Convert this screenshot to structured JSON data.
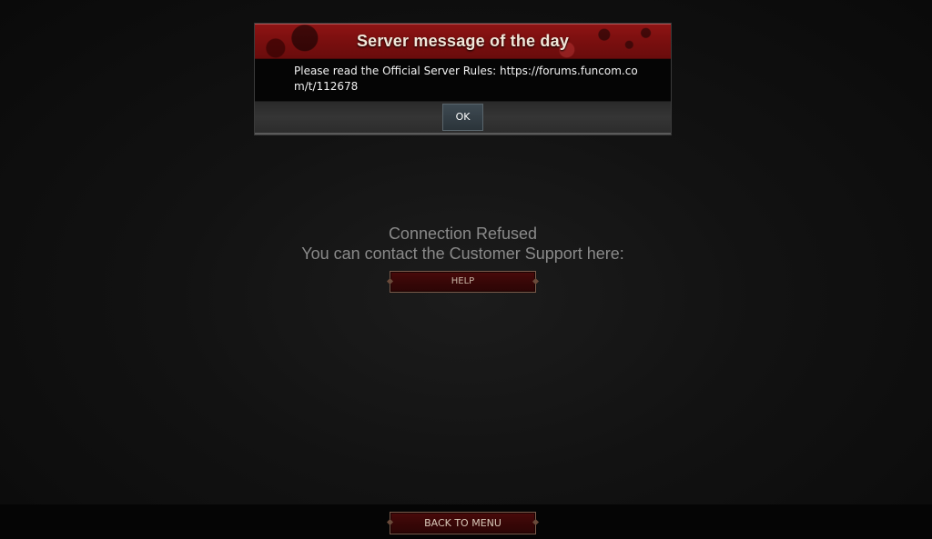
{
  "motd": {
    "title": "Server message of the day",
    "message": "Please read the Official Server Rules: https://forums.funcom.com/t/112678",
    "ok_label": "OK"
  },
  "status": {
    "title": "Connection Refused",
    "subtitle": "You can contact the Customer Support here:",
    "help_label": "HELP"
  },
  "footer": {
    "back_label": "BACK TO MENU"
  },
  "colors": {
    "header_red": "#7a0f0f",
    "button_red": "#380707",
    "status_text": "#8a8a8a"
  }
}
